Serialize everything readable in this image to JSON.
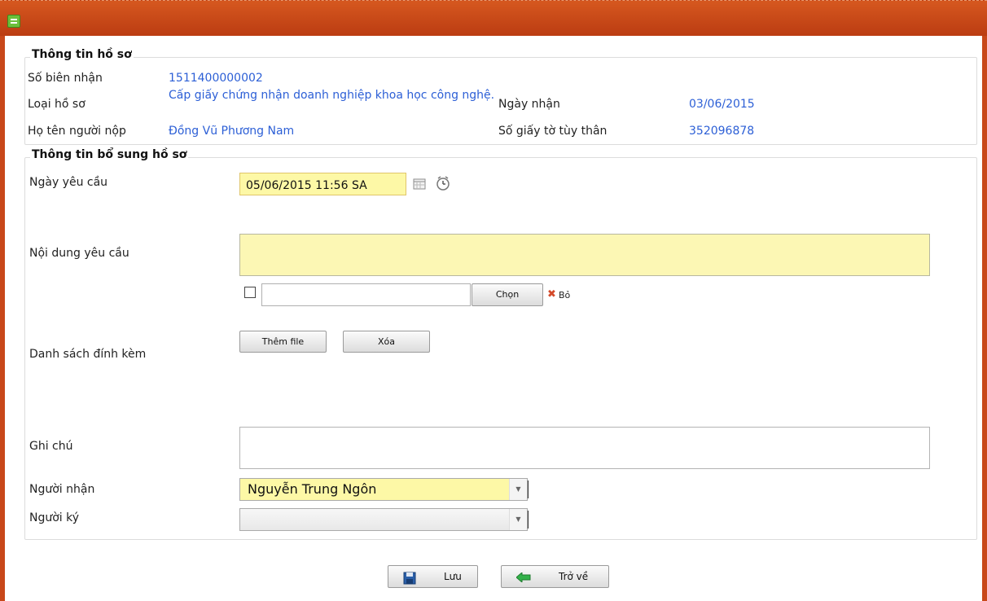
{
  "colors": {
    "titlebar": "#c8481a",
    "link": "#2c5fd6",
    "highlight": "#fdf8a6"
  },
  "info": {
    "legend": "Thông tin hồ sơ",
    "receipt_label": "Số biên nhận",
    "receipt_value": "1511400000002",
    "type_label": "Loại hồ sơ",
    "type_value": "Cấp giấy chứng nhận doanh nghiệp khoa học công nghệ.",
    "received_date_label": "Ngày nhận",
    "received_date_value": "03/06/2015",
    "submitter_label": "Họ tên người nộp",
    "submitter_value": "Đồng Vũ Phương Nam",
    "id_label": "Số giấy tờ tùy thân",
    "id_value": "352096878"
  },
  "extra": {
    "legend": "Thông tin bổ sung hồ sơ",
    "request_date_label": "Ngày yêu cầu",
    "request_date_value": "05/06/2015 11:56 SA",
    "content_label": "Nội dung yêu cầu",
    "choose_label": "Chọn",
    "remove_label": "Bỏ",
    "attachments_label": "Danh sách đính kèm",
    "add_file_label": "Thêm file",
    "delete_label": "Xóa",
    "note_label": "Ghi chú",
    "receiver_label": "Người nhận",
    "receiver_value": "Nguyễn Trung Ngôn",
    "signer_label": "Người ký",
    "signer_value": ""
  },
  "actions": {
    "save_label": "Lưu",
    "back_label": "Trở về"
  }
}
